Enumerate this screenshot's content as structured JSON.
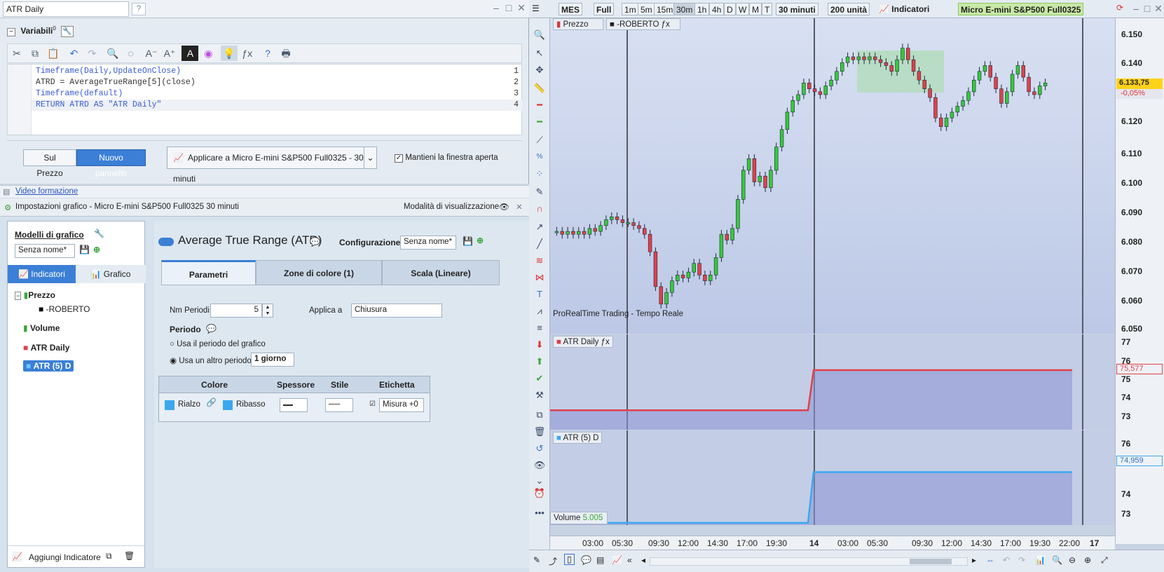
{
  "editor": {
    "title": "ATR Daily",
    "variables_label": "Variabili",
    "variables_count": "0",
    "code_lines": [
      {
        "num": "1",
        "text": "Timeframe(Daily,UpdateOnClose)"
      },
      {
        "num": "2",
        "text": "ATRD = AverageTrueRange[5](close)"
      },
      {
        "num": "3",
        "text": "Timeframe(default)"
      },
      {
        "num": "4",
        "text": "RETURN ATRD AS \"ATR Daily\""
      }
    ],
    "btn_on_price": "Sul Prezzo",
    "btn_new_panel": "Nuovo pannello",
    "apply_to": "Applicare a Micro E-mini S&P500 Full0325 - 30 minuti",
    "keep_window": "Mantieni la finestra aperta"
  },
  "video_link": "Video formazione",
  "settings": {
    "title": "Impostazioni grafico - Micro E-mini S&P500 Full0325 30 minuti",
    "view_mode": "Modalità di visualizzazione",
    "models_label": "Modelli di grafico",
    "model_select": "Senza nome*",
    "tab_indicators": "Indicatori",
    "tab_chart": "Grafico",
    "tree": [
      "Prezzo",
      "-ROBERTO",
      "Volume",
      "ATR Daily",
      "ATR (5) D"
    ],
    "add_indicator": "Aggiungi Indicatore",
    "indicator_name": "Average True Range (ATR)",
    "config_label": "Configurazione:",
    "config_value": "Senza nome*",
    "tab_params": "Parametri",
    "tab_colorzone": "Zone di colore (1)",
    "tab_scale": "Scala (Lineare)",
    "periods_label": "Nm Periodi",
    "periods_value": "5",
    "apply_label": "Applica a",
    "apply_value": "Chiusura",
    "period_title": "Periodo",
    "radio_chart": "Usa il periodo del grafico",
    "radio_other": "Usa un altro periodo :",
    "other_period": "1 giorno",
    "col_color": "Colore",
    "col_thickness": "Spessore",
    "col_style": "Stile",
    "col_label": "Etichetta",
    "rise": "Rialzo",
    "fall": "Ribasso",
    "label_value": "Misura +0"
  },
  "chart": {
    "symbol": "MES",
    "mode": "Full",
    "timeframes": [
      "1m",
      "5m",
      "15m",
      "30m",
      "1h",
      "4h",
      "D",
      "W",
      "M",
      "T"
    ],
    "interval": "30 minuti",
    "units": "200 unità",
    "indicators_btn": "Indicatori",
    "instrument": "Micro E-mini S&P500 Full0325",
    "price_tag": "Prezzo",
    "roberto_tag": "-ROBERTO",
    "realtime": "ProRealTime Trading - Tempo Reale",
    "atr_daily_label": "ATR Daily",
    "atr5_label": "ATR (5) D",
    "volume_label": "Volume",
    "volume_value": "5.005",
    "price_last": "6.133,75",
    "price_change": "-0,05%",
    "atr_daily_last": "75,577",
    "atr5_last": "74,959",
    "price_ticks": [
      "6.150",
      "6.140",
      "6.130",
      "6.120",
      "6.110",
      "6.100",
      "6.090",
      "6.080",
      "6.070",
      "6.060",
      "6.050"
    ],
    "atr1_ticks": [
      "77",
      "76",
      "75",
      "74",
      "73"
    ],
    "atr2_ticks": [
      "76",
      "75",
      "74",
      "73"
    ],
    "x_ticks": [
      "03:00",
      "05:30",
      "09:30",
      "12:00",
      "14:30",
      "17:00",
      "19:30",
      "14",
      "03:00",
      "05:30",
      "09:30",
      "12:00",
      "14:30",
      "17:00",
      "19:30",
      "22:00",
      "17"
    ],
    "colors": {
      "up": "#36c93a",
      "down": "#e0404a",
      "atr_daily": "#e0404a",
      "atr5": "#3aa8f0",
      "highlight": "#a6dca8"
    }
  },
  "chart_data": {
    "type": "line",
    "series": [
      {
        "name": "ATR Daily",
        "values": [
          73.3,
          73.3,
          75.577,
          75.577
        ]
      },
      {
        "name": "ATR (5) D",
        "values": [
          72.6,
          72.6,
          74.959,
          74.959
        ]
      }
    ]
  }
}
